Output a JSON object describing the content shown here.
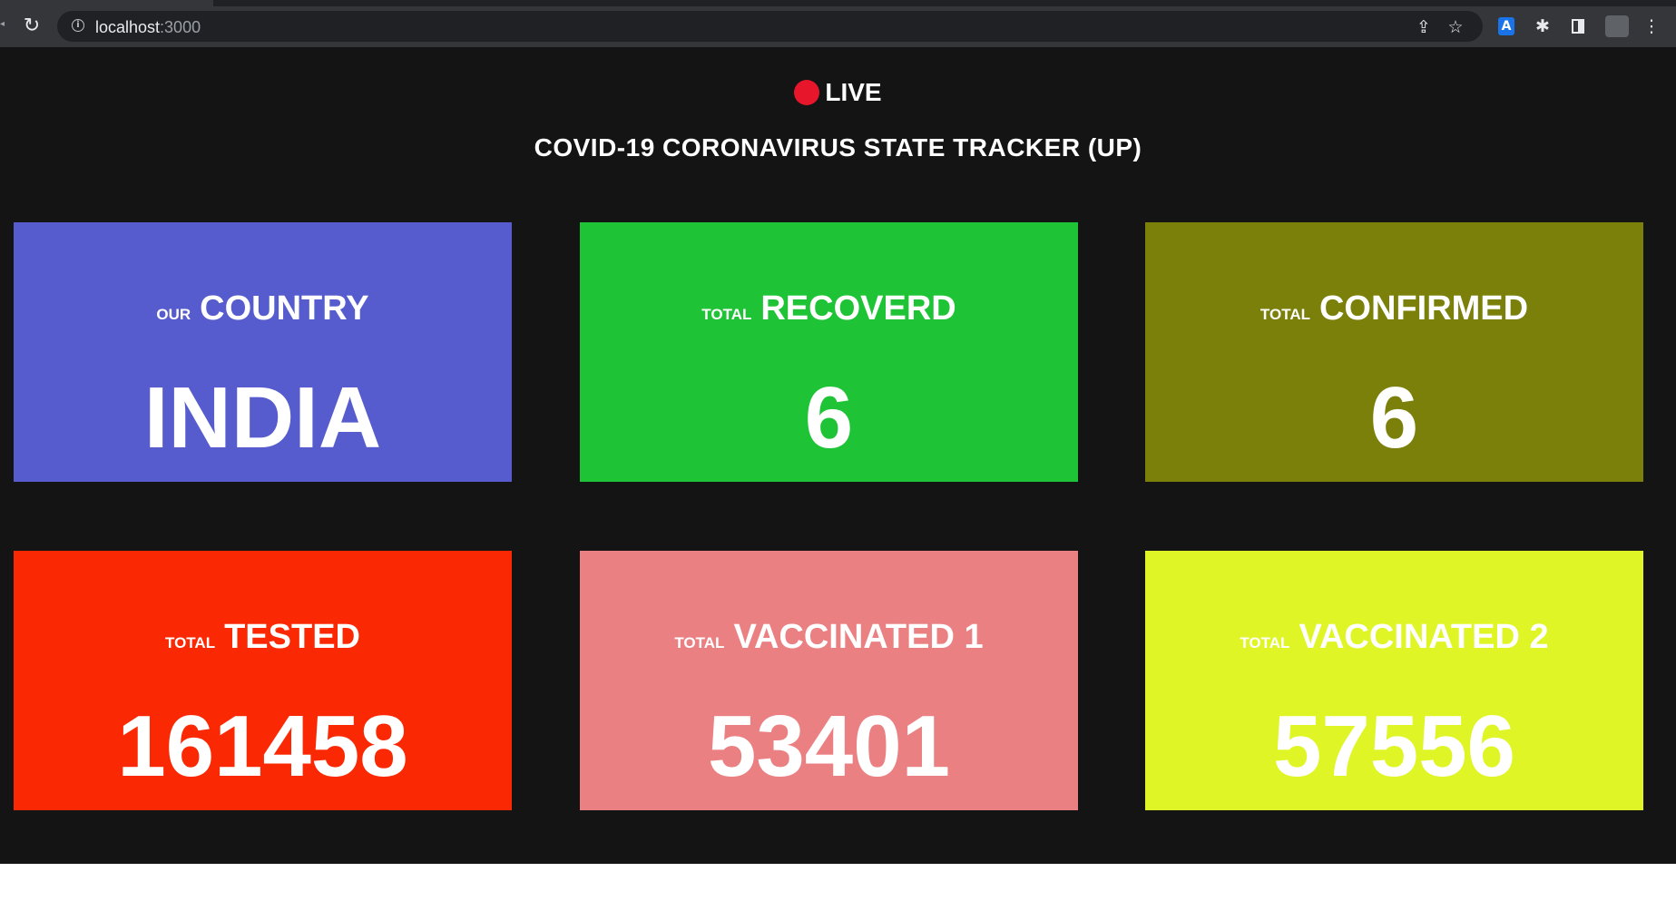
{
  "browser": {
    "url_host": "localhost",
    "url_port": ":3000",
    "reload_icon": "reload-icon",
    "info_icon": "info-icon",
    "share_icon": "share-icon",
    "bookmark_icon": "star-icon",
    "extension_icon": "puzzle-icon",
    "sidepanel_icon": "side-panel-icon",
    "menu_icon": "kebab-menu-icon"
  },
  "header": {
    "live": "LIVE",
    "title": "COVID-19 CORONAVIRUS STATE TRACKER (UP)",
    "live_color": "#e8162b"
  },
  "cards": [
    {
      "small": "OUR",
      "big": "COUNTRY",
      "value": "INDIA",
      "color": "#565ccd"
    },
    {
      "small": "TOTAL",
      "big": "RECOVERD",
      "value": "6",
      "color": "#1ec435"
    },
    {
      "small": "TOTAL",
      "big": "CONFIRMED",
      "value": "6",
      "color": "#7a800a"
    },
    {
      "small": "TOTAL",
      "big": "TESTED",
      "value": "161458",
      "color": "#fb2804"
    },
    {
      "small": "TOTAL",
      "big": "VACCINATED 1",
      "value": "53401",
      "color": "#eb8083"
    },
    {
      "small": "TOTAL",
      "big": "VACCINATED 2",
      "value": "57556",
      "color": "#e0f525"
    }
  ],
  "colors": {
    "page_background": "#141414",
    "chrome_background": "#35363a"
  }
}
